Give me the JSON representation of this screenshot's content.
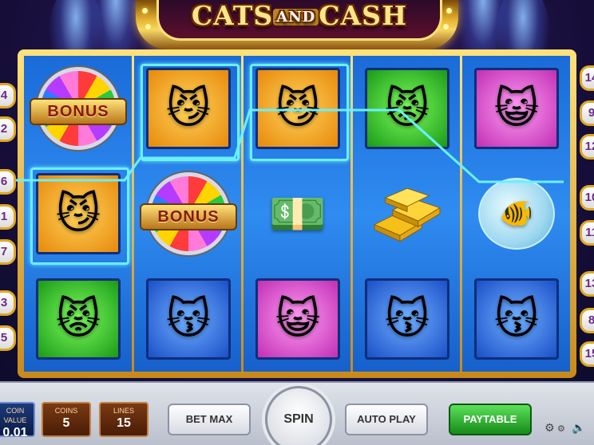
{
  "game": {
    "title_part1": "CATS",
    "title_and": "AND",
    "title_part2": "CASH"
  },
  "reels": {
    "columns": [
      [
        {
          "symbol": "bonus-wheel",
          "label": "BONUS"
        },
        {
          "symbol": "grey-cat-banker",
          "label": ""
        },
        {
          "symbol": "tabby-cat-suit",
          "label": ""
        }
      ],
      [
        {
          "symbol": "grey-cat-banker",
          "label": ""
        },
        {
          "symbol": "bonus-wheel",
          "label": "BONUS"
        },
        {
          "symbol": "black-cat-red-dress",
          "label": ""
        }
      ],
      [
        {
          "symbol": "grey-cat-banker",
          "label": ""
        },
        {
          "symbol": "cash-stack",
          "label": ""
        },
        {
          "symbol": "white-cat-pink-boa",
          "label": ""
        }
      ],
      [
        {
          "symbol": "tabby-cat-suit",
          "label": ""
        },
        {
          "symbol": "gold-bars",
          "label": ""
        },
        {
          "symbol": "black-cat-red-dress",
          "label": ""
        }
      ],
      [
        {
          "symbol": "white-cat-pink-boa",
          "label": ""
        },
        {
          "symbol": "goldfish-bowl",
          "label": ""
        },
        {
          "symbol": "black-cat-red-dress",
          "label": ""
        }
      ]
    ]
  },
  "paylines": {
    "left": [
      "4",
      "2",
      "6",
      "1",
      "7",
      "3",
      "5"
    ],
    "right": [
      "14",
      "9",
      "12",
      "10",
      "11",
      "13",
      "8",
      "15"
    ]
  },
  "controls": {
    "coin_value_label": "COIN VALUE",
    "coin_value": "0.01",
    "coins_label": "COINS",
    "coins_value": "5",
    "lines_label": "LINES",
    "lines_value": "15",
    "bet_max": "BET MAX",
    "spin": "SPIN",
    "auto_play": "AUTO PLAY",
    "paytable": "PAYTABLE",
    "settings_icon": "gear-icon",
    "sound_icon": "speaker-icon"
  },
  "colors": {
    "reel_bg": "#2f8cf0",
    "frame_gold": "#e5b233",
    "payline_highlight": "#6af0ff",
    "paytable_green": "#2bb22a"
  }
}
